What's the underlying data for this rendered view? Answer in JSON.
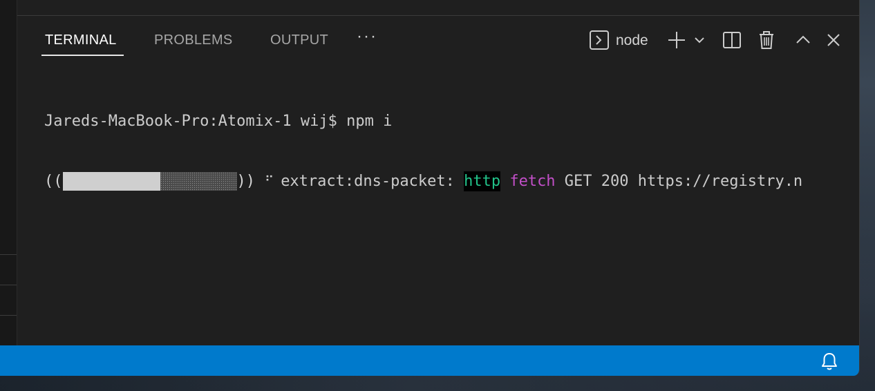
{
  "panel": {
    "tabs": [
      {
        "label": "TERMINAL",
        "active": true
      },
      {
        "label": "PROBLEMS",
        "active": false
      },
      {
        "label": "OUTPUT",
        "active": false
      }
    ],
    "more_label": "···",
    "toolbar": {
      "shell_icon": "terminal-prompt-icon",
      "shell_label": "node",
      "new_icon": "plus-icon",
      "dropdown_icon": "chevron-down-icon",
      "split_icon": "split-panel-icon",
      "kill_icon": "trash-icon",
      "maximize_icon": "chevron-up-icon",
      "close_icon": "close-icon"
    }
  },
  "terminal": {
    "prompt_line": "Jareds-MacBook-Pro:Atomix-1 wij$ npm i",
    "progress": {
      "open_bracket": "((",
      "close_bracket": "))",
      "fraction": 0.56,
      "spinner": "⠋",
      "stage": "extract:dns-packet: ",
      "http_word": "http",
      "fetch_word": "fetch",
      "rest": " GET 200 https://registry.n"
    }
  },
  "statusbar": {
    "bell_icon": "bell-icon",
    "color": "#007acc"
  },
  "colors": {
    "panel_bg": "#1f1f1f",
    "http": "#22c38a",
    "fetch": "#c24fc8",
    "tab_active": "#ffffff",
    "tab_inactive": "#a7a7a7"
  }
}
